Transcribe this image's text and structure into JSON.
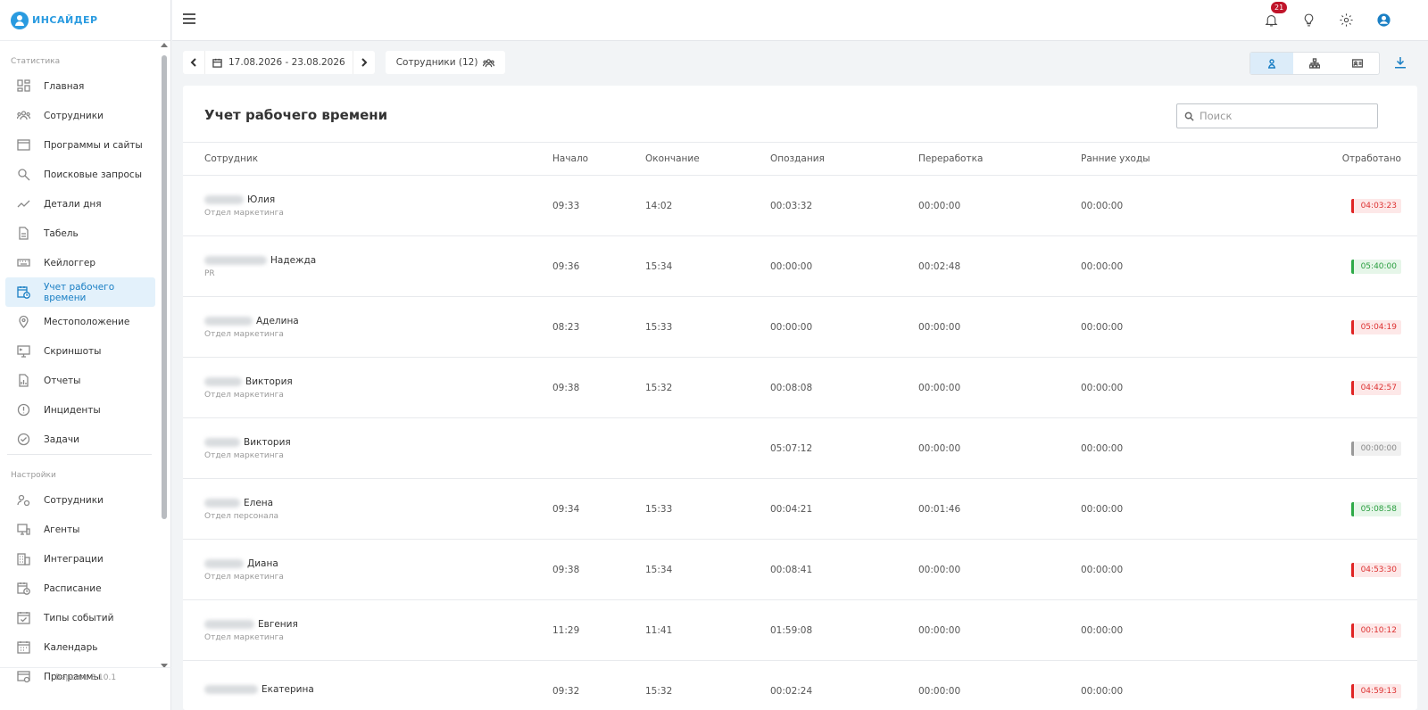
{
  "app": {
    "logo_text": "ИНСАЙДЕР",
    "version": "Версия: 3.10.1"
  },
  "sidebar": {
    "sections": [
      {
        "title": "Статистика",
        "items": [
          {
            "label": "Главная",
            "icon": "dashboard-icon"
          },
          {
            "label": "Сотрудники",
            "icon": "users-icon"
          },
          {
            "label": "Программы и сайты",
            "icon": "window-icon"
          },
          {
            "label": "Поисковые запросы",
            "icon": "search-icon"
          },
          {
            "label": "Детали дня",
            "icon": "trend-icon"
          },
          {
            "label": "Табель",
            "icon": "document-icon"
          },
          {
            "label": "Кейлоггер",
            "icon": "keyboard-icon"
          },
          {
            "label": "Учет рабочего времени",
            "icon": "clock-calendar-icon",
            "active": true
          },
          {
            "label": "Местоположение",
            "icon": "location-pin-icon"
          },
          {
            "label": "Скриншоты",
            "icon": "monitor-icon"
          },
          {
            "label": "Отчеты",
            "icon": "report-icon"
          },
          {
            "label": "Инциденты",
            "icon": "alert-circle-icon"
          },
          {
            "label": "Задачи",
            "icon": "check-circle-icon"
          }
        ]
      },
      {
        "title": "Настройки",
        "items": [
          {
            "label": "Сотрудники",
            "icon": "user-settings-icon"
          },
          {
            "label": "Агенты",
            "icon": "agent-monitor-icon"
          },
          {
            "label": "Интеграции",
            "icon": "building-icon"
          },
          {
            "label": "Расписание",
            "icon": "schedule-icon"
          },
          {
            "label": "Типы событий",
            "icon": "event-check-icon"
          },
          {
            "label": "Календарь",
            "icon": "calendar-icon"
          },
          {
            "label": "Программы",
            "icon": "programs-icon"
          }
        ]
      }
    ]
  },
  "topbar": {
    "notifications_count": "21"
  },
  "toolbar": {
    "date_range": "17.08.2026 - 23.08.2026",
    "employees_label": "Сотрудники (12)"
  },
  "card": {
    "title": "Учет рабочего времени",
    "search_placeholder": "Поиск"
  },
  "table": {
    "columns": [
      "Сотрудник",
      "Начало",
      "Окончание",
      "Опоздания",
      "Переработка",
      "Ранние уходы",
      "Отработано"
    ],
    "rows": [
      {
        "name": "Юлия",
        "dept": "Отдел маркетинга",
        "start": "09:33",
        "end": "14:02",
        "late": "00:03:32",
        "over": "00:00:00",
        "early": "00:00:00",
        "worked": "04:03:23",
        "status": "red"
      },
      {
        "name": "Надежда",
        "dept": "PR",
        "start": "09:36",
        "end": "15:34",
        "late": "00:00:00",
        "over": "00:02:48",
        "early": "00:00:00",
        "worked": "05:40:00",
        "status": "green"
      },
      {
        "name": "Аделина",
        "dept": "Отдел маркетинга",
        "start": "08:23",
        "end": "15:33",
        "late": "00:00:00",
        "over": "00:00:00",
        "early": "00:00:00",
        "worked": "05:04:19",
        "status": "red"
      },
      {
        "name": "Виктория",
        "dept": "Отдел маркетинга",
        "start": "09:38",
        "end": "15:32",
        "late": "00:08:08",
        "over": "00:00:00",
        "early": "00:00:00",
        "worked": "04:42:57",
        "status": "red"
      },
      {
        "name": "Виктория",
        "dept": "Отдел маркетинга",
        "start": "",
        "end": "",
        "late": "05:07:12",
        "over": "00:00:00",
        "early": "00:00:00",
        "worked": "00:00:00",
        "status": "grey"
      },
      {
        "name": "Елена",
        "dept": "Отдел персонала",
        "start": "09:34",
        "end": "15:33",
        "late": "00:04:21",
        "over": "00:01:46",
        "early": "00:00:00",
        "worked": "05:08:58",
        "status": "green"
      },
      {
        "name": "Диана",
        "dept": "Отдел маркетинга",
        "start": "09:38",
        "end": "15:34",
        "late": "00:08:41",
        "over": "00:00:00",
        "early": "00:00:00",
        "worked": "04:53:30",
        "status": "red"
      },
      {
        "name": "Евгения",
        "dept": "Отдел маркетинга",
        "start": "11:29",
        "end": "11:41",
        "late": "01:59:08",
        "over": "00:00:00",
        "early": "00:00:00",
        "worked": "00:10:12",
        "status": "red"
      },
      {
        "name": "Екатерина",
        "dept": "",
        "start": "09:32",
        "end": "15:32",
        "late": "00:02:24",
        "over": "00:00:00",
        "early": "00:00:00",
        "worked": "04:59:13",
        "status": "red"
      }
    ]
  },
  "colors": {
    "accent": "#1a7fc4",
    "brand": "#2a9be0",
    "red": "#e02424",
    "green": "#2eaa48",
    "grey": "#999999"
  }
}
